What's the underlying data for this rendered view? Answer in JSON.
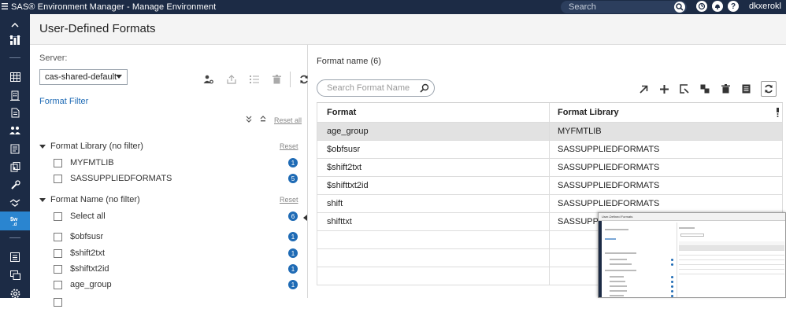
{
  "topbar": {
    "app_title": "SAS® Environment Manager - Manage Environment",
    "search_placeholder": "Search",
    "user_name": "dkxerokl",
    "help_glyph": "?"
  },
  "leftnav": {
    "items": [
      "collapse-icon",
      "dashboard-icon",
      "table-icon",
      "building-icon",
      "document-icon",
      "users-icon",
      "report-icon",
      "server-config-icon",
      "tools-icon",
      "handshake-icon",
      "user-defined-formats-icon",
      "list-icon",
      "window-icon",
      "settings-icon"
    ]
  },
  "header": {
    "title": "User-Defined Formats"
  },
  "leftpane": {
    "server_label": "Server:",
    "server_value": "cas-shared-default",
    "filter_link": "Format Filter",
    "reset_all": "Reset all",
    "groups": [
      {
        "title": "Format Library (no filter)",
        "reset": "Reset",
        "items": [
          {
            "label": "MYFMTLIB",
            "count": "1"
          },
          {
            "label": "SASSUPPLIEDFORMATS",
            "count": "5"
          }
        ]
      },
      {
        "title": "Format Name (no filter)",
        "reset": "Reset",
        "items": [
          {
            "label": "Select all",
            "count": "6"
          },
          {
            "label": "$obfsusr",
            "count": "1"
          },
          {
            "label": "$shift2txt",
            "count": "1"
          },
          {
            "label": "$shiftxt2id",
            "count": "1"
          },
          {
            "label": "age_group",
            "count": "1"
          }
        ]
      }
    ]
  },
  "rightpane": {
    "format_count": "Format name (6)",
    "search_placeholder": "Search Format Name",
    "columns": [
      "Format",
      "Format Library"
    ],
    "rows": [
      {
        "format": "age_group",
        "library": "MYFMTLIB"
      },
      {
        "format": "$obfsusr",
        "library": "SASSUPPLIEDFORMATS"
      },
      {
        "format": "$shift2txt",
        "library": "SASSUPPLIEDFORMATS"
      },
      {
        "format": "$shifttxt2id",
        "library": "SASSUPPLIEDFORMATS"
      },
      {
        "format": "shift",
        "library": "SASSUPPLIEDFORMATS"
      },
      {
        "format": "shifttxt",
        "library": "SASSUPPLIEDFORMATS"
      }
    ]
  },
  "thumbnail": {
    "title": "User-Defined Formats"
  },
  "colors": {
    "nav_bg": "#1c2b45",
    "accent": "#2a85d0",
    "link": "#1f6bb5"
  }
}
